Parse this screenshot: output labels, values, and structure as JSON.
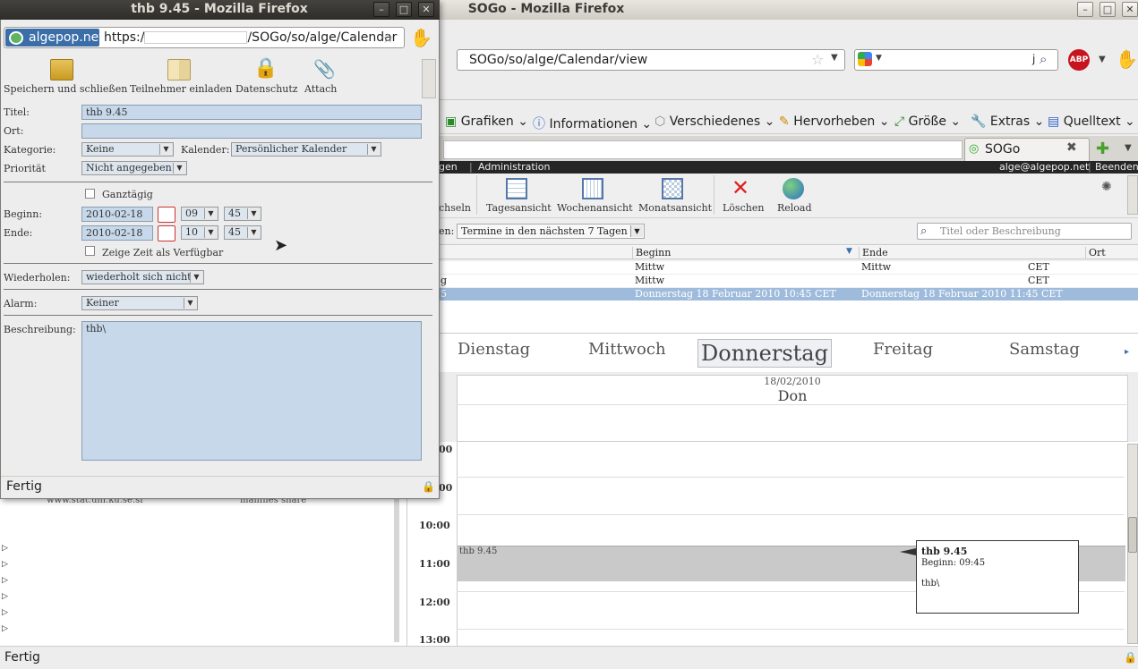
{
  "main_window": {
    "title": "SOGo - Mozilla Firefox",
    "url": "SOGo/so/alge/Calendar/view",
    "search_text": "j",
    "adblock_label": "ABP",
    "bookmarks": [
      "Grafiken",
      "Informationen",
      "Verschiedenes",
      "Hervorheben",
      "Größe",
      "Extras",
      "Quelltext"
    ],
    "tab_label": "SOGo",
    "status": "Fertig"
  },
  "sogo": {
    "topbar_left": "gen",
    "topbar_admin": "Administration",
    "user": "alge@algepop.net",
    "logout": "Beenden",
    "toolbar": {
      "switch": "chseln",
      "day_view": "Tagesansicht",
      "week_view": "Wochenansicht",
      "month_view": "Monatsansicht",
      "delete": "Löschen",
      "reload": "Reload"
    },
    "filter_label": "en:",
    "filter_value": "Termine in den nächsten 7 Tagen",
    "search_placeholder": "Titel oder Beschreibung",
    "list_columns": {
      "begin": "Beginn",
      "end": "Ende",
      "location": "Ort"
    },
    "list_rows": [
      {
        "title": "",
        "begin": "Mittw",
        "end": "Mittw",
        "end_tz": "CET"
      },
      {
        "title": "g",
        "begin": "Mittw",
        "end": "",
        "end_tz": "CET"
      },
      {
        "title": "5",
        "begin": "Donnerstag 18 Februar 2010 10:45 CET",
        "end": "Donnerstag 18 Februar 2010 11:45 CET",
        "end_tz": ""
      }
    ],
    "days": [
      "Dienstag",
      "Mittwoch",
      "Donnerstag",
      "Freitag",
      "Samstag"
    ],
    "day_date": "18/02/2010",
    "day_short": "Don",
    "hours": [
      "00",
      "00",
      "10:00",
      "11:00",
      "12:00",
      "13:00"
    ],
    "event": {
      "title": "thb 9.45"
    },
    "tooltip": {
      "title": "thb 9.45",
      "begin": "Beginn: 09:45",
      "description": "thb\\"
    },
    "left_panel_text": "www.stat.uni.ku.se.sr",
    "left_panel_text2": "mailfiles share"
  },
  "popup": {
    "title": "thb 9.45 - Mozilla Firefox",
    "site_identity": "algepop.net",
    "url_prefix": "https:/",
    "url_suffix": "/SOGo/so/alge/Calendar",
    "toolbar": {
      "save_close": "Speichern und schließen",
      "invite": "Teilnehmer einladen",
      "privacy": "Datenschutz",
      "attach": "Attach"
    },
    "form": {
      "title_label": "Titel:",
      "title_value": "thb 9.45",
      "location_label": "Ort:",
      "location_value": "",
      "category_label": "Kategorie:",
      "category_value": "Keine",
      "calendar_label": "Kalender:",
      "calendar_value": "Persönlicher Kalender",
      "priority_label": "Priorität",
      "priority_value": "Nicht angegeben",
      "allday_label": "Ganztägig",
      "begin_label": "Beginn:",
      "begin_date": "2010-02-18",
      "begin_hour": "09",
      "begin_min": "45",
      "end_label": "Ende:",
      "end_date": "2010-02-18",
      "end_hour": "10",
      "end_min": "45",
      "show_available_label": "Zeige Zeit als Verfügbar",
      "repeat_label": "Wiederholen:",
      "repeat_value": "wiederholt sich nicht",
      "alarm_label": "Alarm:",
      "alarm_value": "Keiner",
      "description_label": "Beschreibung:",
      "description_value": "thb\\"
    },
    "status": "Fertig"
  }
}
